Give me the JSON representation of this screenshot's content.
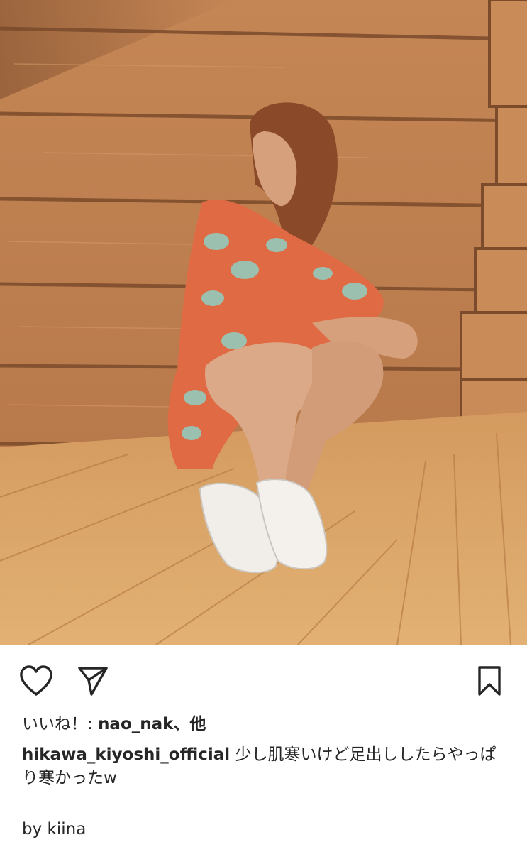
{
  "post": {
    "image": {
      "subject": "woman-crouching-by-wooden-wall"
    },
    "actions": {
      "like_icon": "heart-outline-icon",
      "share_icon": "paper-plane-icon",
      "save_icon": "bookmark-outline-icon"
    },
    "likes": {
      "prefix": "いいね！: ",
      "username": "nao_nak",
      "suffix": "、他"
    },
    "caption": {
      "username": "hikawa_kiyoshi_official",
      "text": " 少し肌寒いけど足出ししたらやっぱり寒かったw"
    },
    "credit": "by kiina",
    "colors": {
      "text": "#262626",
      "background": "#ffffff"
    }
  }
}
